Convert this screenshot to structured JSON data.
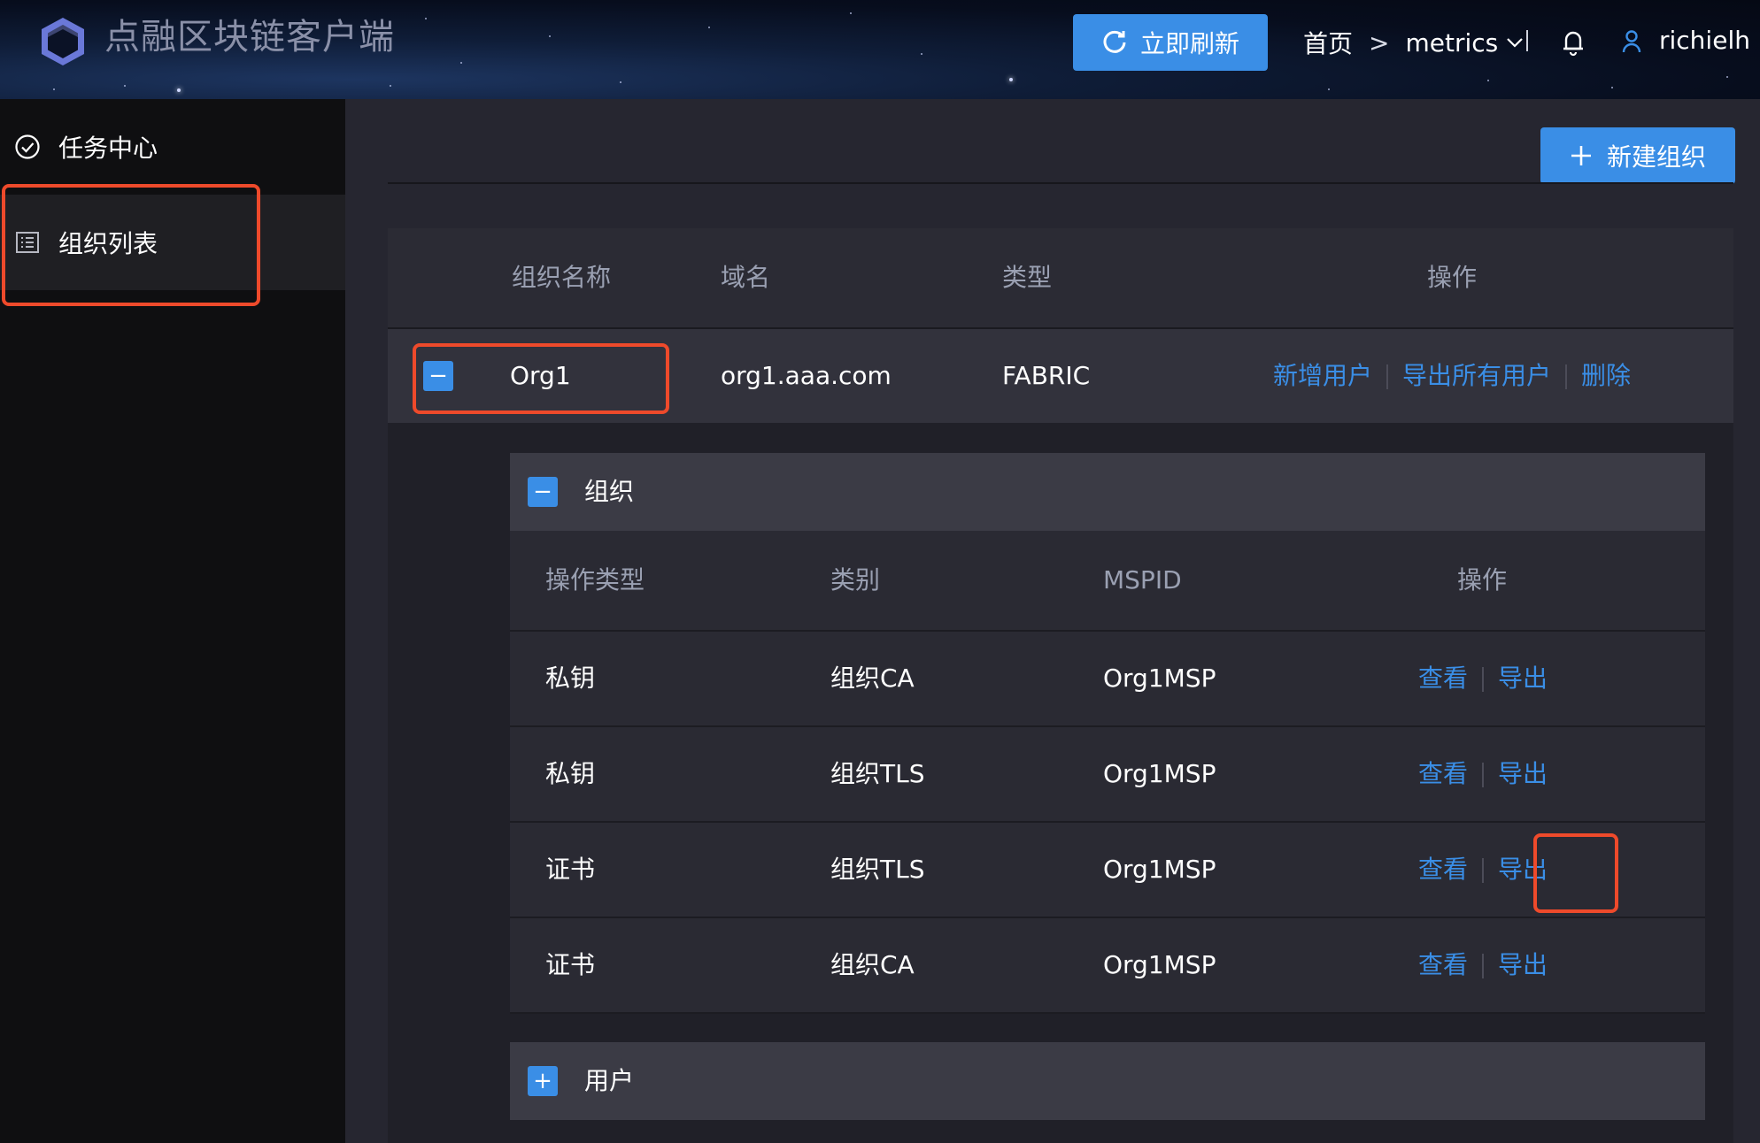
{
  "header": {
    "app_title": "点融区块链客户端",
    "refresh_label": "立即刷新",
    "breadcrumb": {
      "home": "首页",
      "separator": ">",
      "current": "metrics"
    },
    "user": "richielh"
  },
  "sidebar": {
    "items": [
      {
        "label": "任务中心",
        "icon": "check-circle-icon"
      },
      {
        "label": "组织列表",
        "icon": "list-icon"
      }
    ]
  },
  "main": {
    "new_org_label": "新建组织",
    "table": {
      "headers": [
        "组织名称",
        "域名",
        "类型",
        "操作"
      ],
      "row": {
        "name": "Org1",
        "domain": "org1.aaa.com",
        "type": "FABRIC",
        "actions": [
          "新增用户",
          "导出所有用户",
          "删除"
        ]
      }
    },
    "org_panel": {
      "title": "组织",
      "toggle": "−",
      "headers": [
        "操作类型",
        "类别",
        "MSPID",
        "操作"
      ],
      "rows": [
        {
          "op": "私钥",
          "category": "组织CA",
          "mspid": "Org1MSP",
          "view": "查看",
          "export": "导出"
        },
        {
          "op": "私钥",
          "category": "组织TLS",
          "mspid": "Org1MSP",
          "view": "查看",
          "export": "导出"
        },
        {
          "op": "证书",
          "category": "组织TLS",
          "mspid": "Org1MSP",
          "view": "查看",
          "export": "导出"
        },
        {
          "op": "证书",
          "category": "组织CA",
          "mspid": "Org1MSP",
          "view": "查看",
          "export": "导出"
        }
      ]
    },
    "user_panel": {
      "title": "用户",
      "toggle": "+"
    },
    "row_toggle": "−"
  },
  "colors": {
    "accent": "#3a8ee6",
    "highlight": "#ee4a2b"
  }
}
